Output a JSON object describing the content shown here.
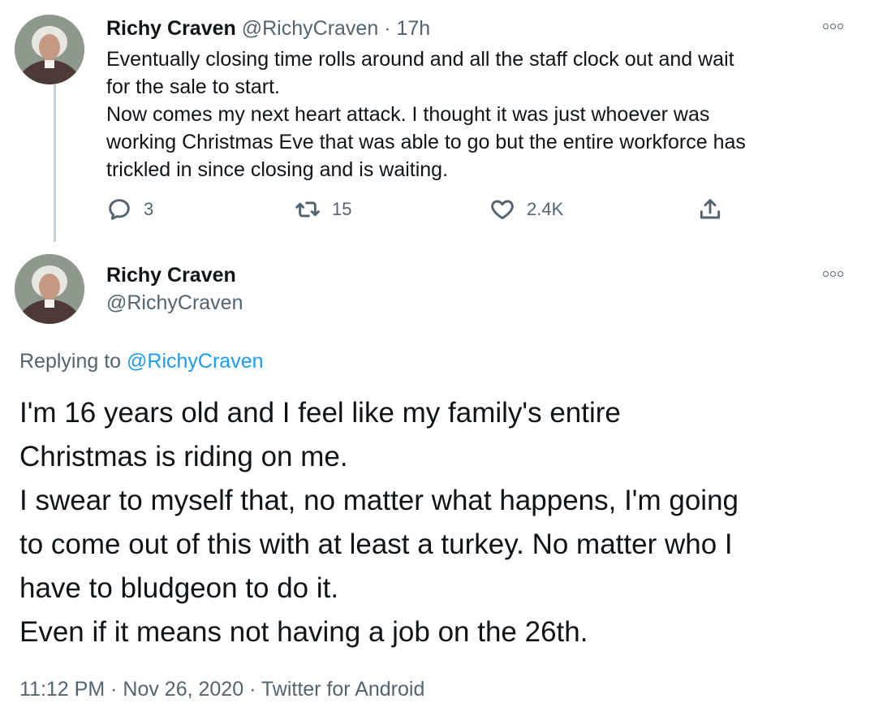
{
  "tweet1": {
    "name": "Richy Craven",
    "handle": "@RichyCraven",
    "separator": "·",
    "time": "17h",
    "lines": [
      "Eventually closing time rolls around and all the staff clock out and wait",
      "for the sale to start.",
      "Now comes my next heart attack. I thought it was just whoever was",
      "working Christmas Eve that was able to go but the entire workforce has",
      "trickled in since closing and is waiting."
    ],
    "actions": {
      "reply_count": "3",
      "retweet_count": "15",
      "like_count": "2.4K"
    },
    "icons": [
      "reply-icon",
      "retweet-icon",
      "like-icon",
      "share-icon",
      "more-icon"
    ]
  },
  "tweet2": {
    "name": "Richy Craven",
    "handle": "@RichyCraven",
    "replying_prefix": "Replying to",
    "replying_handle": "@RichyCraven",
    "lines": [
      "I'm 16 years old and I feel like my family's entire",
      "Christmas is riding on me.",
      "I swear to myself that, no matter what happens, I'm going",
      "to come out of this with at least a turkey. No matter who I",
      "have to bludgeon to do it.",
      "Even if it means not having a job on the 26th."
    ],
    "time": "11:12 PM",
    "separator": "·",
    "date": "Nov 26, 2020",
    "source": "Twitter for Android"
  },
  "colors": {
    "text": "#0f1419",
    "muted": "#536471",
    "link": "#1d9bf0",
    "thread_line": "#c4cfd6"
  }
}
